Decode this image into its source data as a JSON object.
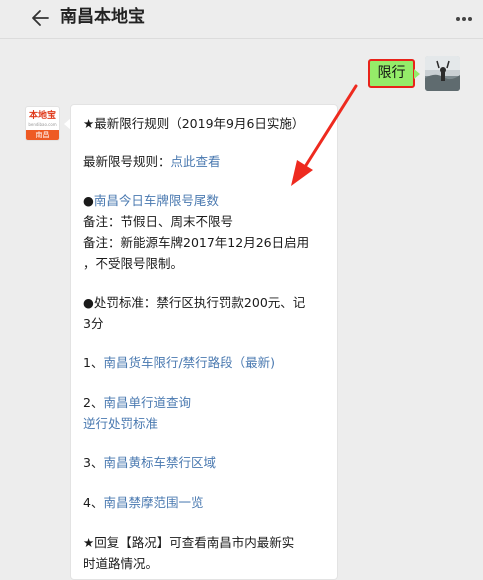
{
  "header": {
    "title": "南昌本地宝",
    "back_icon": "back-arrow-icon",
    "more_icon": "more-dots-icon"
  },
  "user_message": {
    "text": "限行",
    "avatar_icon": "user-avatar"
  },
  "bot": {
    "logo_text": "本地宝",
    "logo_subtext": "bendibao.com",
    "logo_city": "南昌"
  },
  "message": {
    "heading": "★最新限行规则（2019年9月6日实施）",
    "rule_prefix": "最新限号规则：",
    "rule_link": "点此查看",
    "today_bullet": "●",
    "today_link": "南昌今日车牌限号尾数",
    "note1": "备注：节假日、周末不限号",
    "note2_line1": "备注：新能源车牌2017年12月26日启用",
    "note2_line2": "，不受限号限制。",
    "penalty_line1": "●处罚标准：禁行区执行罚款200元、记",
    "penalty_line2": "3分",
    "item1_num": "1、",
    "item1_link": "南昌货车限行/禁行路段（最新)",
    "item2_num": "2、",
    "item2_link": "南昌单行道查询",
    "item2_link2": "逆行处罚标准",
    "item3_num": "3、",
    "item3_link": "南昌黄标车禁行区域",
    "item4_num": "4、",
    "item4_link": "南昌禁摩范围一览",
    "reply_line1": "★回复【路况】可查看南昌市内最新实",
    "reply_line2": "时道路情况。"
  },
  "colors": {
    "link": "#4a79b0",
    "user_bubble": "#95ec69",
    "highlight": "#e8231a",
    "background": "#ededed"
  }
}
